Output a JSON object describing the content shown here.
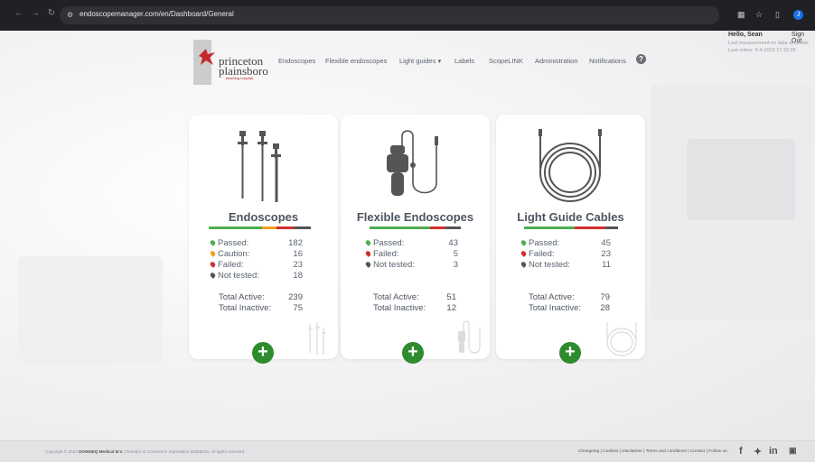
{
  "browser": {
    "url": "endoscopemanager.com/en/Dashboard/General",
    "profile_initial": "J"
  },
  "header": {
    "logo": {
      "line1": "princeton",
      "line2": "plainsboro",
      "tagline": "teaching hospital"
    },
    "menu": [
      {
        "label": "Endoscopes"
      },
      {
        "label": "Flexible endoscopes"
      },
      {
        "label": "Light guides ▾"
      },
      {
        "label": "Labels"
      },
      {
        "label": "ScopeLINK"
      },
      {
        "label": "Administration"
      },
      {
        "label": "Notifications"
      }
    ],
    "help": "?"
  },
  "user": {
    "greeting": "Hello, Sean",
    "sign_out": "Sign Out",
    "last_measurement": "Last measurement:no data available",
    "last_online": "Last online:      6-4-2023 17:15:29"
  },
  "cards": [
    {
      "title": "Endoscopes",
      "stats": [
        {
          "label": "Passed:",
          "value": "182",
          "color": "#4caf50"
        },
        {
          "label": "Caution:",
          "value": "16",
          "color": "#f0a020"
        },
        {
          "label": "Failed:",
          "value": "23",
          "color": "#d32f2f"
        },
        {
          "label": "Not tested:",
          "value": "18",
          "color": "#555555"
        }
      ],
      "total_active_label": "Total Active:",
      "total_active": "239",
      "total_inactive_label": "Total Inactive:",
      "total_inactive": "75"
    },
    {
      "title": "Flexible Endoscopes",
      "stats": [
        {
          "label": "Passed:",
          "value": "43",
          "color": "#4caf50"
        },
        {
          "label": "Failed:",
          "value": "5",
          "color": "#d32f2f"
        },
        {
          "label": "Not tested:",
          "value": "3",
          "color": "#555555"
        }
      ],
      "total_active_label": "Total Active:",
      "total_active": "51",
      "total_inactive_label": "Total Inactive:",
      "total_inactive": "12"
    },
    {
      "title": "Light Guide Cables",
      "stats": [
        {
          "label": "Passed:",
          "value": "45",
          "color": "#4caf50"
        },
        {
          "label": "Failed:",
          "value": "23",
          "color": "#d32f2f"
        },
        {
          "label": "Not tested:",
          "value": "11",
          "color": "#555555"
        }
      ],
      "total_active_label": "Total Active:",
      "total_active": "79",
      "total_inactive_label": "Total Inactive:",
      "total_inactive": "28"
    }
  ],
  "footer": {
    "copyright_prefix": "Copyright © 2024",
    "company": "DOWDEQ Medical B.V.",
    "copyright_suffix": "Chamber of Commerce registration 60356610. All rights reserved.",
    "links": "Changelog | Cookies | Disclaimer | Terms and conditions | Contact | Follow us:"
  },
  "colors": {
    "accent_green": "#2e8b2e",
    "passed": "#4caf50",
    "caution": "#f0a020",
    "failed": "#d32f2f",
    "not_tested": "#555555"
  }
}
